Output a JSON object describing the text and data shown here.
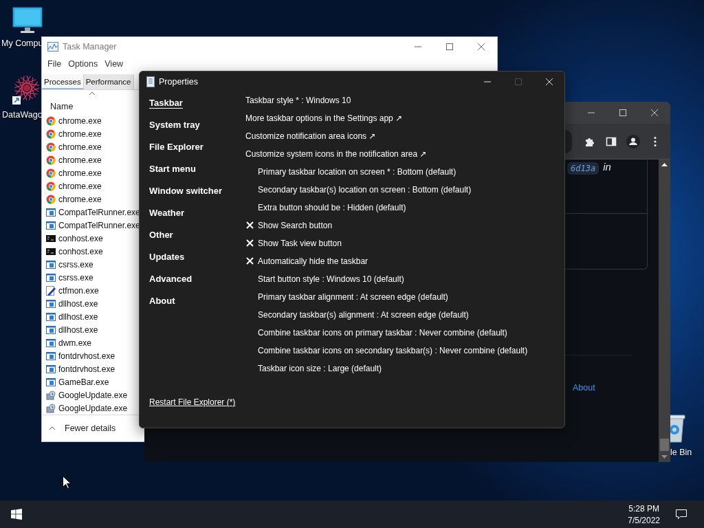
{
  "desktop": {
    "icons": [
      {
        "kind": "computer",
        "label": "My Compu"
      },
      {
        "kind": "shortcut",
        "label": "DataWago"
      },
      {
        "kind": "recycle-bin",
        "label": "le Bin"
      }
    ]
  },
  "task_manager": {
    "title": "Task Manager",
    "menu": [
      "File",
      "Options",
      "View"
    ],
    "tabs": [
      {
        "label": "Processes",
        "selected": true
      },
      {
        "label": "Performance",
        "selected": false
      }
    ],
    "column": "Name",
    "processes": [
      {
        "kind": "chrome",
        "name": "chrome.exe"
      },
      {
        "kind": "chrome",
        "name": "chrome.exe"
      },
      {
        "kind": "chrome",
        "name": "chrome.exe"
      },
      {
        "kind": "chrome",
        "name": "chrome.exe"
      },
      {
        "kind": "chrome",
        "name": "chrome.exe"
      },
      {
        "kind": "chrome",
        "name": "chrome.exe"
      },
      {
        "kind": "chrome",
        "name": "chrome.exe"
      },
      {
        "kind": "app",
        "name": "CompatTelRunner.exe"
      },
      {
        "kind": "app",
        "name": "CompatTelRunner.exe"
      },
      {
        "kind": "console",
        "name": "conhost.exe"
      },
      {
        "kind": "console",
        "name": "conhost.exe"
      },
      {
        "kind": "app",
        "name": "csrss.exe"
      },
      {
        "kind": "app",
        "name": "csrss.exe"
      },
      {
        "kind": "pen",
        "name": "ctfmon.exe"
      },
      {
        "kind": "app",
        "name": "dllhost.exe"
      },
      {
        "kind": "app",
        "name": "dllhost.exe"
      },
      {
        "kind": "app",
        "name": "dllhost.exe"
      },
      {
        "kind": "app",
        "name": "dwm.exe"
      },
      {
        "kind": "app",
        "name": "fontdrvhost.exe"
      },
      {
        "kind": "app",
        "name": "fontdrvhost.exe"
      },
      {
        "kind": "app",
        "name": "GameBar.exe"
      },
      {
        "kind": "installer",
        "name": "GoogleUpdate.exe"
      },
      {
        "kind": "installer",
        "name": "GoogleUpdate.exe"
      }
    ],
    "footer": "Fewer details"
  },
  "browser": {
    "commit": "6d13a",
    "text": "in",
    "link": "About"
  },
  "properties": {
    "title": "Properties",
    "nav": [
      {
        "label": "Taskbar",
        "selected": true
      },
      {
        "label": "System tray",
        "selected": false
      },
      {
        "label": "File Explorer",
        "selected": false
      },
      {
        "label": "Start menu",
        "selected": false
      },
      {
        "label": "Window switcher",
        "selected": false
      },
      {
        "label": "Weather",
        "selected": false
      },
      {
        "label": "Other",
        "selected": false
      },
      {
        "label": "Updates",
        "selected": false
      },
      {
        "label": "Advanced",
        "selected": false
      },
      {
        "label": "About",
        "selected": false
      }
    ],
    "settings": [
      {
        "kind": "primary",
        "text": "Taskbar style * : Windows 10"
      },
      {
        "kind": "link",
        "text": "More taskbar options in the Settings app ↗"
      },
      {
        "kind": "link",
        "text": "Customize notification area icons ↗"
      },
      {
        "kind": "link",
        "text": "Customize system icons in the notification area ↗"
      },
      {
        "kind": "setting",
        "text": "Primary taskbar location on screen * : Bottom (default)"
      },
      {
        "kind": "setting",
        "text": "Secondary taskbar(s) location on screen : Bottom (default)"
      },
      {
        "kind": "setting",
        "text": "Extra button should be : Hidden (default)"
      },
      {
        "kind": "checkbox",
        "text": "Show Search button",
        "checked": true
      },
      {
        "kind": "checkbox",
        "text": "Show Task view button",
        "checked": true
      },
      {
        "kind": "checkbox",
        "text": "Automatically hide the taskbar",
        "checked": true
      },
      {
        "kind": "setting",
        "text": "Start button style : Windows 10 (default)"
      },
      {
        "kind": "setting",
        "text": "Primary taskbar alignment : At screen edge (default)"
      },
      {
        "kind": "setting",
        "text": "Secondary taskbar(s) alignment : At screen edge (default)"
      },
      {
        "kind": "setting",
        "text": "Combine taskbar icons on primary taskbar : Never combine (default)"
      },
      {
        "kind": "setting",
        "text": "Combine taskbar icons on secondary taskbar(s) : Never combine (default)"
      },
      {
        "kind": "setting",
        "text": "Taskbar icon size : Large (default)"
      }
    ],
    "footer_link": "Restart File Explorer (*)"
  },
  "taskbar": {
    "time": "5:28 PM",
    "date": "7/5/2022"
  }
}
